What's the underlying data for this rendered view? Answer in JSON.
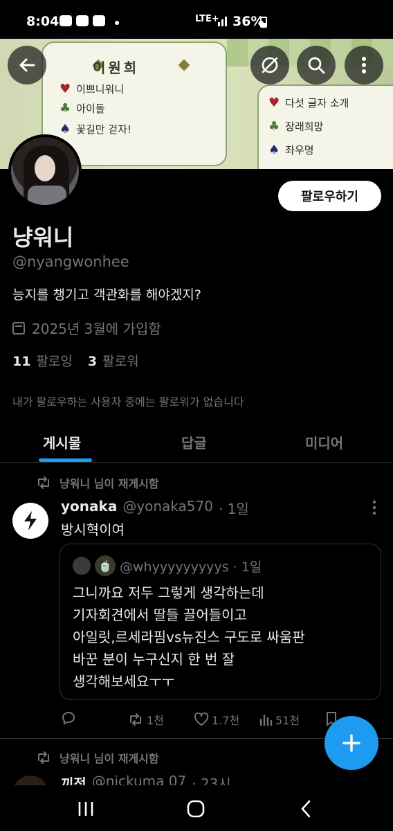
{
  "status_bar": {
    "time": "8:04",
    "network": "LTE+",
    "battery": "36%"
  },
  "banner": {
    "card_title": "이원희",
    "left_items": [
      "이쁘니워니",
      "아이돌",
      "꽃길만 걷자!"
    ],
    "right_items": [
      "다섯 글자 소개",
      "장래희망",
      "좌우명"
    ]
  },
  "top_actions": [
    "back-icon",
    "mute-icon",
    "search-icon",
    "more-icon"
  ],
  "profile": {
    "follow_button": "팔로우하기",
    "display_name": "냥워니",
    "handle": "@nyangwonhee",
    "bio": "능지를 챙기고 객관화를 해야겠지?",
    "joined": "2025년 3월에 가입함",
    "following_count": "11",
    "following_label": "팔로잉",
    "followers_count": "3",
    "followers_label": "팔로워",
    "follower_note": "내가 팔로우하는 사용자 중에는 팔로워가 없습니다"
  },
  "tabs": [
    "게시물",
    "답글",
    "미디어"
  ],
  "active_tab": 0,
  "posts": [
    {
      "repost_label": "냥워니 님이 재게시함",
      "author_name": "yonaka",
      "author_handle": "@yonaka570",
      "time": "· 1일",
      "text": "방시혁이여",
      "quote": {
        "handle": "@whyyyyyyyyys",
        "time": "· 1일",
        "lines": [
          "그니까요 저두 그렇게 생각하는데",
          "기자회견에서 딸들 끌어들이고",
          "아일릿,르세라핌vs뉴진스 구도로 싸움판",
          "바꾼 분이 누구신지 한 번 잘",
          "생각해보세요ㅜㅜ"
        ]
      },
      "repost_count": "1천",
      "like_count": "1.7천",
      "view_count": "51천"
    },
    {
      "repost_label": "냥워니 님이 재게시함",
      "author_name": "끼점",
      "author_handle": "@nickuma 07",
      "time": "· 23시"
    }
  ],
  "colors": {
    "accent": "#1d9bf0",
    "background": "#000000",
    "text_primary": "#e7e9ea",
    "text_secondary": "#71767b"
  }
}
